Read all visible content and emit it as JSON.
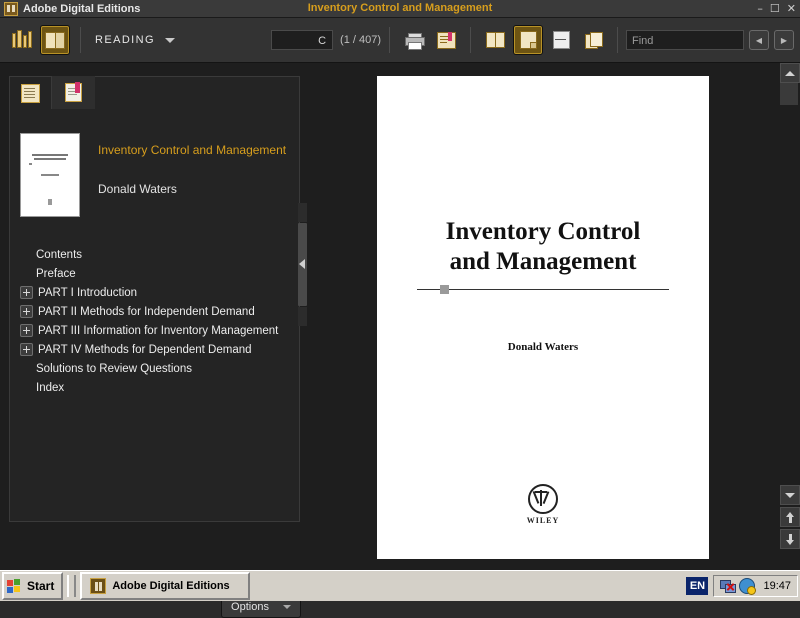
{
  "window": {
    "app_title": "Adobe Digital Editions",
    "document_title": "Inventory Control and Management",
    "app_icon": "book-app-icon",
    "controls": {
      "minimize": "–",
      "maximize": "☐",
      "close": "✕"
    }
  },
  "toolbar": {
    "library_icon": "bookshelf-icon",
    "reading_icon": "open-book-icon",
    "mode_label": "READING",
    "mode_caret_icon": "chevron-down-icon",
    "page_input_value": "C",
    "page_count_label": "(1 / 407)",
    "print_icon": "printer-icon",
    "bookmark_icon": "bookmark-book-icon",
    "view_two_page_icon": "two-page-view-icon",
    "view_single_page_icon": "single-page-view-icon",
    "view_fit_width_icon": "fit-width-icon",
    "view_duplicate_icon": "duplicate-page-icon",
    "find_placeholder": "Find",
    "find_value": "",
    "prev_icon": "triangle-left-icon",
    "next_icon": "triangle-right-icon",
    "prev_glyph": "◀",
    "next_glyph": "▶"
  },
  "panel": {
    "tabs": [
      {
        "name": "table-of-contents",
        "icon": "toc-list-icon",
        "active": true
      },
      {
        "name": "bookmarks",
        "icon": "bookmark-ribbon-icon",
        "active": false
      }
    ],
    "book": {
      "title": "Inventory Control and Management",
      "author": "Donald Waters",
      "cover_thumbnail": "book-cover-thumbnail"
    },
    "toc": [
      {
        "label": "Contents",
        "expandable": false
      },
      {
        "label": "Preface",
        "expandable": false
      },
      {
        "label": "PART I Introduction",
        "expandable": true
      },
      {
        "label": "PART II Methods for Independent Demand",
        "expandable": true
      },
      {
        "label": "PART III Information for Inventory Management",
        "expandable": true
      },
      {
        "label": "PART IV Methods for Dependent Demand",
        "expandable": true
      },
      {
        "label": "Solutions to Review Questions",
        "expandable": false
      },
      {
        "label": "Index",
        "expandable": false
      }
    ],
    "options_label": "Options",
    "options_caret_icon": "chevron-down-icon"
  },
  "reader": {
    "page": {
      "title_line_1": "Inventory Control",
      "title_line_2": "and Management",
      "author": "Donald Waters",
      "publisher_logo": "wiley-logo",
      "publisher_name": "WILEY"
    },
    "scrollbar": {
      "up_icon": "scroll-up-icon",
      "goto_icon": "chevron-down-icon",
      "page_up_icon": "page-up-arrow-icon",
      "page_down_icon": "page-down-arrow-icon"
    }
  },
  "taskbar": {
    "start_label": "Start",
    "start_icon": "windows-logo-icon",
    "items": [
      {
        "label": "Adobe Digital Editions",
        "icon": "book-app-icon"
      }
    ],
    "tray": {
      "language": "EN",
      "network_icon": "network-disconnected-icon",
      "security_icon": "security-shield-icon",
      "clock": "19:47"
    }
  },
  "colors": {
    "accent_gold": "#d79e1d",
    "chrome_dark": "#333333",
    "panel_bg": "#1e1e1e",
    "page_white": "#ffffff",
    "taskbar": "#d4d0c8"
  }
}
